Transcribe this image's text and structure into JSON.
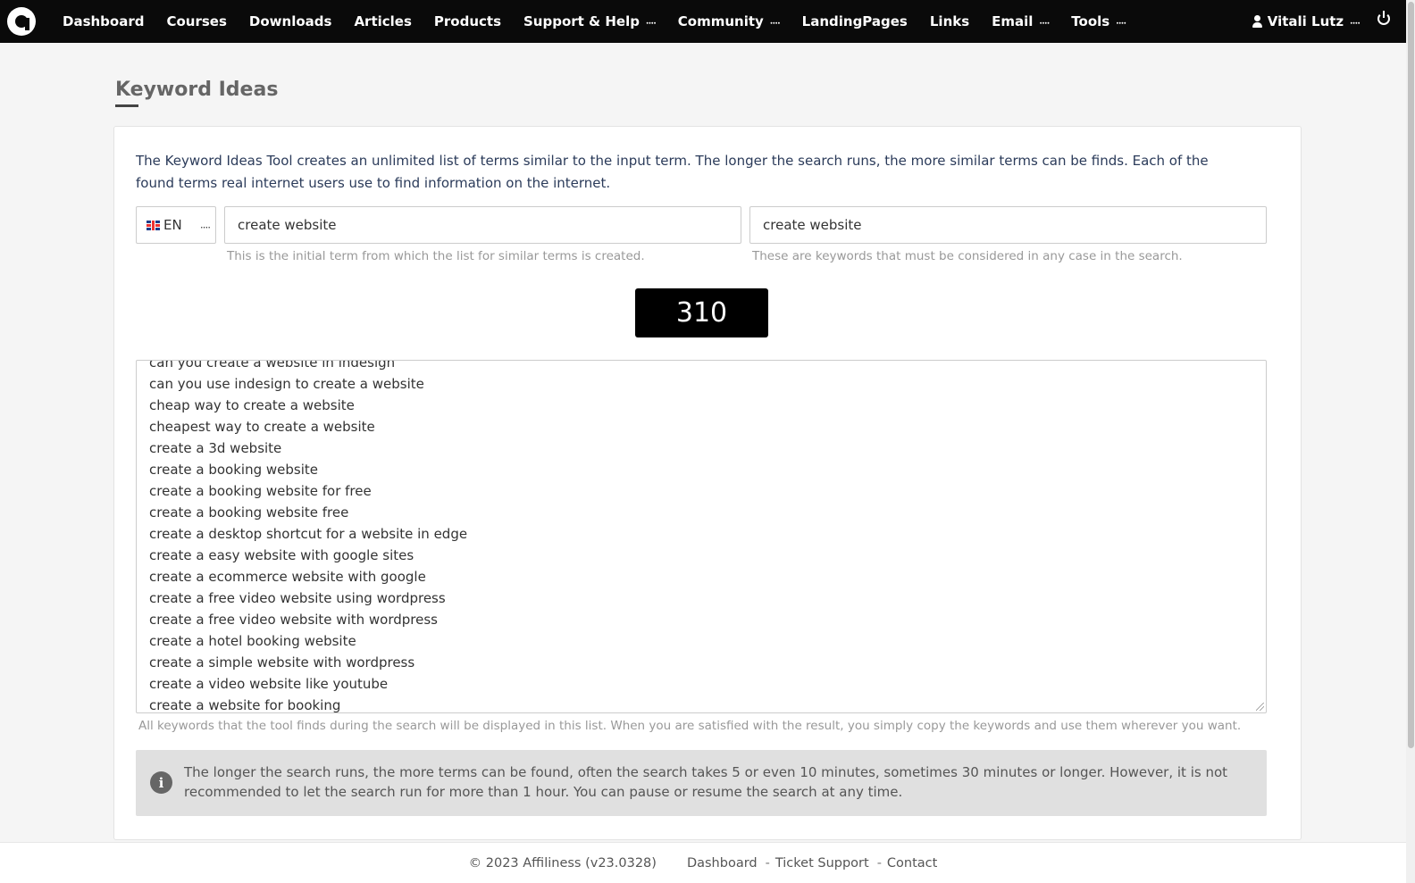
{
  "nav": {
    "items": [
      {
        "label": "Dashboard",
        "dropdown": false
      },
      {
        "label": "Courses",
        "dropdown": false
      },
      {
        "label": "Downloads",
        "dropdown": false
      },
      {
        "label": "Articles",
        "dropdown": false
      },
      {
        "label": "Products",
        "dropdown": false
      },
      {
        "label": "Support & Help",
        "dropdown": true
      },
      {
        "label": "Community",
        "dropdown": true
      },
      {
        "label": "LandingPages",
        "dropdown": false
      },
      {
        "label": "Links",
        "dropdown": false
      },
      {
        "label": "Email",
        "dropdown": true
      },
      {
        "label": "Tools",
        "dropdown": true
      }
    ],
    "user_name": "Vitali Lutz",
    "chevron": "᠁"
  },
  "page": {
    "title": "Keyword Ideas",
    "intro": "The Keyword Ideas Tool creates an unlimited list of terms similar to the input term. The longer the search runs, the more similar terms can be finds. Each of the found terms real internet users use to find information on the internet."
  },
  "form": {
    "language": "EN",
    "initial_term": "create website",
    "initial_term_hint": "This is the initial term from which the list for similar terms is created.",
    "required_keywords": "create website",
    "required_keywords_hint": "These are keywords that must be considered in any case in the search."
  },
  "counter": "310",
  "results": {
    "keywords": [
      "can you create a website in indesign",
      "can you use indesign to create a website",
      "cheap way to create a website",
      "cheapest way to create a website",
      "create a 3d website",
      "create a booking website",
      "create a booking website for free",
      "create a booking website free",
      "create a desktop shortcut for a website in edge",
      "create a easy website with google sites",
      "create a ecommerce website with google",
      "create a free video website using wordpress",
      "create a free video website with wordpress",
      "create a hotel booking website",
      "create a simple website with wordpress",
      "create a video website like youtube",
      "create a website for booking"
    ],
    "hint": "All keywords that the tool finds during the search will be displayed in this list. When you are satisfied with the result, you simply copy the keywords and use them wherever you want."
  },
  "info": {
    "text": "The longer the search runs, the more terms can be found, often the search takes 5 or even 10 minutes, sometimes 30 minutes or longer. However, it is not recommended to let the search run for more than 1 hour. You can pause or resume the search at any time."
  },
  "footer": {
    "copyright": "© 2023 Affiliness (v23.0328)",
    "links": [
      "Dashboard",
      "Ticket Support",
      "Contact"
    ],
    "separator": "-"
  }
}
